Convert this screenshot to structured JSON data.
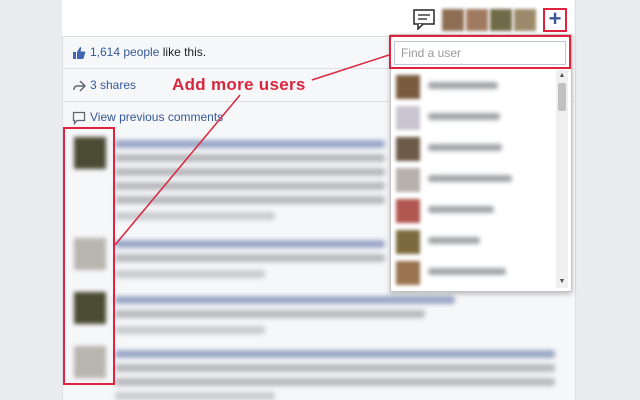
{
  "post": {
    "likes_count": "1,614 people",
    "likes_suffix": " like this.",
    "shares": "3 shares",
    "view_previous": "View previous comments"
  },
  "toolbar": {
    "add_button": "+"
  },
  "search": {
    "placeholder": "Find a user"
  },
  "annotation": {
    "callout": "Add more users"
  },
  "colors": {
    "accent": "#e0223f",
    "link": "#365899"
  },
  "scroll": {
    "up": "▲",
    "down": "▼"
  }
}
